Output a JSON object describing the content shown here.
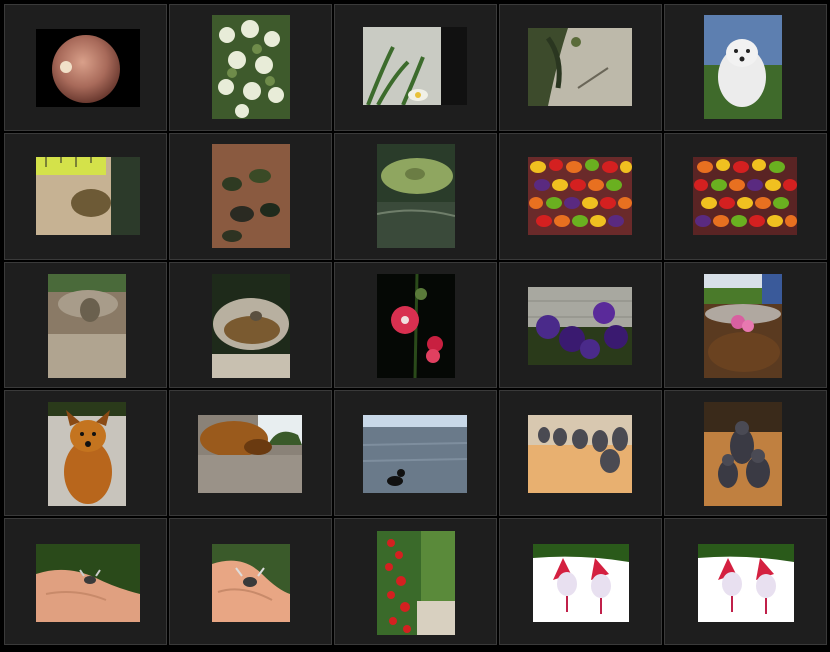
{
  "gallery": {
    "rows": 5,
    "cols": 5,
    "thumbnails": [
      {
        "icon": "fundus-image-icon"
      },
      {
        "icon": "white-flowers-icon"
      },
      {
        "icon": "plant-wall-icon"
      },
      {
        "icon": "grass-shadow-icon"
      },
      {
        "icon": "white-dog-icon"
      },
      {
        "icon": "frog-ruler-icon"
      },
      {
        "icon": "water-frogs-icon"
      },
      {
        "icon": "frog-on-leaf-icon"
      },
      {
        "icon": "colorful-candies-icon"
      },
      {
        "icon": "colorful-candies-icon"
      },
      {
        "icon": "stone-face-icon"
      },
      {
        "icon": "birdbath-icon"
      },
      {
        "icon": "red-hollyhock-icon"
      },
      {
        "icon": "purple-pansies-icon"
      },
      {
        "icon": "pond-flowers-icon"
      },
      {
        "icon": "brown-dog-icon"
      },
      {
        "icon": "sleeping-dog-icon"
      },
      {
        "icon": "dog-swimming-icon"
      },
      {
        "icon": "buddha-statues-icon"
      },
      {
        "icon": "buddha-statues-icon"
      },
      {
        "icon": "fly-on-hand-icon"
      },
      {
        "icon": "fly-on-hand-icon"
      },
      {
        "icon": "red-flowers-icon"
      },
      {
        "icon": "fuchsia-icon"
      },
      {
        "icon": "fuchsia-icon"
      }
    ]
  }
}
